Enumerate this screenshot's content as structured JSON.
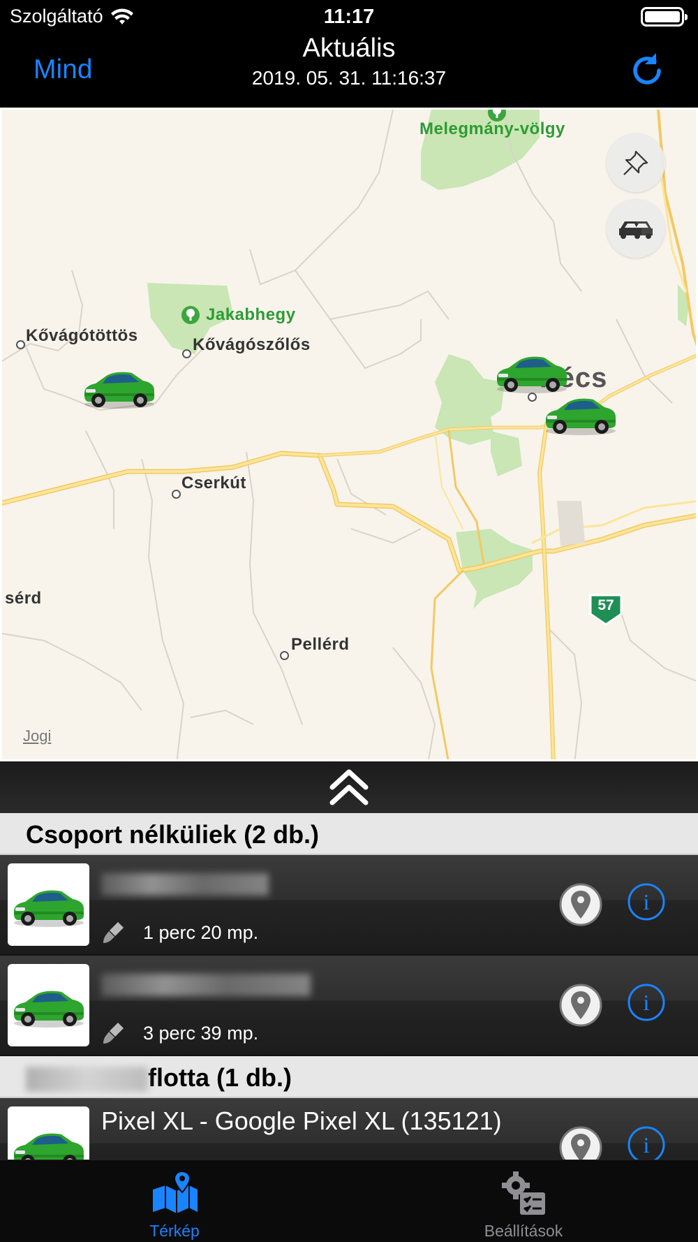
{
  "status_bar": {
    "carrier": "Szolgáltató",
    "time": "11:17",
    "wifi_icon": "wifi-icon",
    "battery_icon": "battery-icon"
  },
  "nav": {
    "left_label": "Mind",
    "title": "Aktuális",
    "subtitle": "2019. 05. 31. 11:16:37",
    "refresh_icon": "refresh-icon",
    "accent_color": "#1a84ff"
  },
  "map": {
    "places": {
      "melegmany": "Melegmány-völgy",
      "jakabhegy": "Jakabhegy",
      "kovagotottos": "Kővágótöttös",
      "kovagoszolos": "Kővágószőlős",
      "pecs": "Pécs",
      "cserkut": "Cserkút",
      "serd": "sérd",
      "pellerd": "Pellérd"
    },
    "road_shield": "57",
    "legal_label": "Jogi",
    "pin_button_icon": "pushpin-icon",
    "cars_button_icon": "cars-icon",
    "vehicle_marker_color": "#2ea52e"
  },
  "drawer": {
    "handle_icon": "double-chevron-up-icon"
  },
  "list": {
    "sections": [
      {
        "title": "Csoport nélküliek (2 db.)",
        "rows": [
          {
            "name": "",
            "duration": "1 perc 20 mp."
          },
          {
            "name": "",
            "duration": "3 perc 39 mp."
          }
        ]
      },
      {
        "title": "flotta (1 db.)",
        "rows": [
          {
            "name": "Pixel XL - Google Pixel XL (135121)",
            "duration": ""
          }
        ]
      }
    ]
  },
  "tabbar": {
    "tabs": [
      {
        "label": "Térkép",
        "icon": "map-icon",
        "active": true
      },
      {
        "label": "Beállítások",
        "icon": "settings-icon",
        "active": false
      }
    ]
  }
}
